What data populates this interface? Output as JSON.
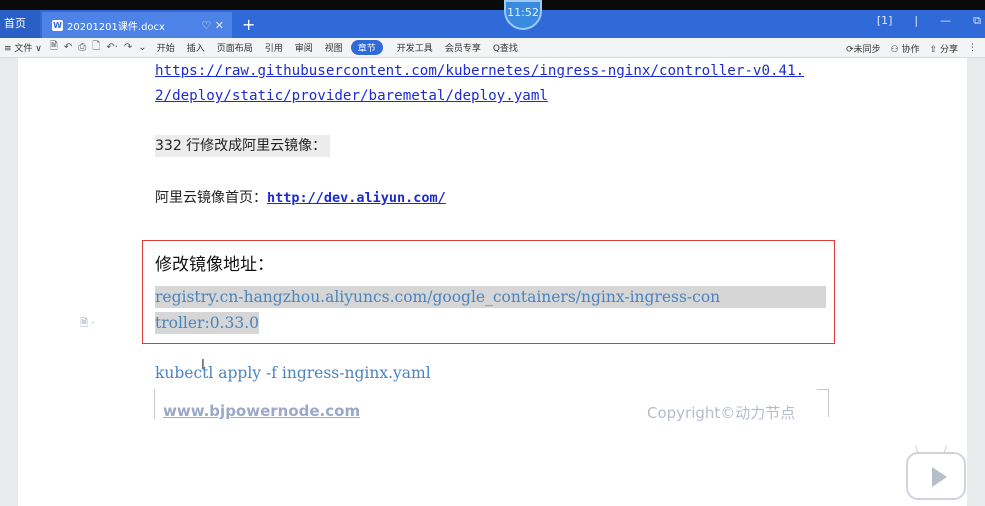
{
  "titlebar": {
    "clock": "11:52",
    "home_tab": "首页",
    "doc_tab": "20201201课件.docx",
    "doc_icon_letter": "W",
    "tab_controls": "♡ ✕",
    "new_tab": "+",
    "win_controls": [
      "[1]",
      "|",
      "—",
      "⧉"
    ]
  },
  "menubar": {
    "file_menu": "≡ 文件 ∨",
    "quick_icons": [
      "🗎",
      "↶",
      "⎙",
      "🗋",
      "↶·",
      "↷",
      "⌄"
    ],
    "tabs": [
      "开始",
      "插入",
      "页面布局",
      "引用",
      "审阅",
      "视图",
      "章节",
      "开发工具",
      "会员专享",
      "Q查找"
    ],
    "active_tab": "章节",
    "right_items": [
      "⟳未同步",
      "⚇ 协作",
      "⇧ 分享",
      "⋮"
    ]
  },
  "document": {
    "link_line_1": "https://raw.githubusercontent.com/kubernetes/ingress-nginx/controller-v0.41.",
    "link_line_2": "2/deploy/static/provider/baremetal/deploy.yaml",
    "line_332": "332 行修改成阿里云镜像：",
    "aliyun_label": "阿里云镜像首页：",
    "aliyun_link": "http://dev.aliyun.com/",
    "box_heading": "修改镜像地址：",
    "image_line_1": "registry.cn-hangzhou.aliyuncs.com/google_containers/nginx-ingress-con",
    "image_line_2": "troller:0.33.0 ",
    "kubectl_cmd": "kubectl apply -f ingress-nginx.yaml",
    "margin_marker": "🗎 ·",
    "cursor": "I"
  },
  "footer": {
    "site": "www.bjpowernode.com",
    "copyright": "Copyright©动力节点"
  },
  "player": {
    "play_icon": "play-icon"
  }
}
